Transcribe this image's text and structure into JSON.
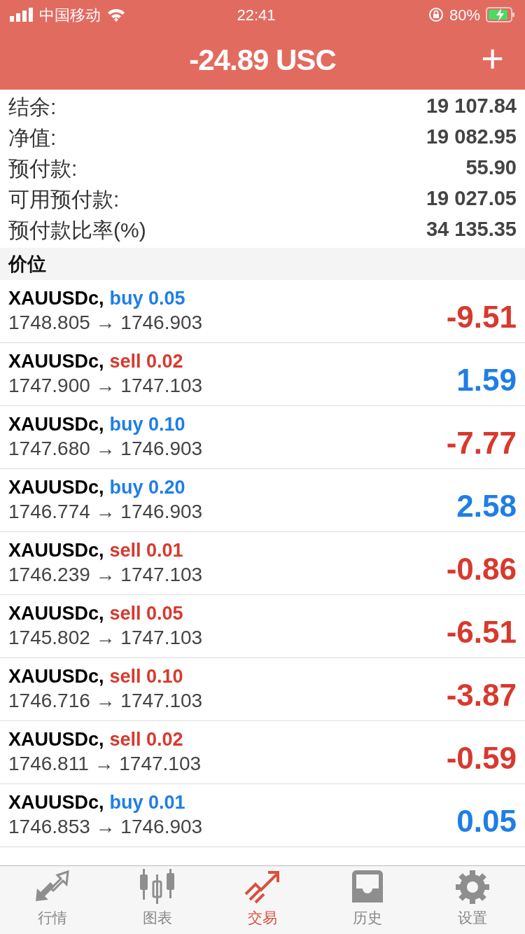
{
  "status_bar": {
    "carrier": "中国移动",
    "time": "22:41",
    "battery": "80%"
  },
  "header": {
    "title": "-24.89 USC",
    "add": "+"
  },
  "summary": [
    {
      "label": "结余:",
      "value": "19 107.84"
    },
    {
      "label": "净值:",
      "value": "19 082.95"
    },
    {
      "label": "预付款:",
      "value": "55.90"
    },
    {
      "label": "可用预付款:",
      "value": "19 027.05"
    },
    {
      "label": "预付款比率(%)",
      "value": "34 135.35"
    }
  ],
  "section": "价位",
  "positions": [
    {
      "symbol": "XAUUSDc,",
      "kind": "buy",
      "order": "buy 0.05",
      "prices": "1748.805 → 1746.903",
      "profit": "-9.51",
      "loss": true
    },
    {
      "symbol": "XAUUSDc,",
      "kind": "sell",
      "order": "sell 0.02",
      "prices": "1747.900 → 1747.103",
      "profit": "1.59",
      "loss": false
    },
    {
      "symbol": "XAUUSDc,",
      "kind": "buy",
      "order": "buy 0.10",
      "prices": "1747.680 → 1746.903",
      "profit": "-7.77",
      "loss": true
    },
    {
      "symbol": "XAUUSDc,",
      "kind": "buy",
      "order": "buy 0.20",
      "prices": "1746.774 → 1746.903",
      "profit": "2.58",
      "loss": false
    },
    {
      "symbol": "XAUUSDc,",
      "kind": "sell",
      "order": "sell 0.01",
      "prices": "1746.239 → 1747.103",
      "profit": "-0.86",
      "loss": true
    },
    {
      "symbol": "XAUUSDc,",
      "kind": "sell",
      "order": "sell 0.05",
      "prices": "1745.802 → 1747.103",
      "profit": "-6.51",
      "loss": true
    },
    {
      "symbol": "XAUUSDc,",
      "kind": "sell",
      "order": "sell 0.10",
      "prices": "1746.716 → 1747.103",
      "profit": "-3.87",
      "loss": true
    },
    {
      "symbol": "XAUUSDc,",
      "kind": "sell",
      "order": "sell 0.02",
      "prices": "1746.811 → 1747.103",
      "profit": "-0.59",
      "loss": true
    },
    {
      "symbol": "XAUUSDc,",
      "kind": "buy",
      "order": "buy 0.01",
      "prices": "1746.853 → 1746.903",
      "profit": "0.05",
      "loss": false
    }
  ],
  "tabs": [
    {
      "label": "行情",
      "kind": "quotes",
      "selected": false
    },
    {
      "label": "图表",
      "kind": "chart",
      "selected": false
    },
    {
      "label": "交易",
      "kind": "trade",
      "selected": true
    },
    {
      "label": "历史",
      "kind": "history",
      "selected": false
    },
    {
      "label": "设置",
      "kind": "settings",
      "selected": false
    }
  ]
}
